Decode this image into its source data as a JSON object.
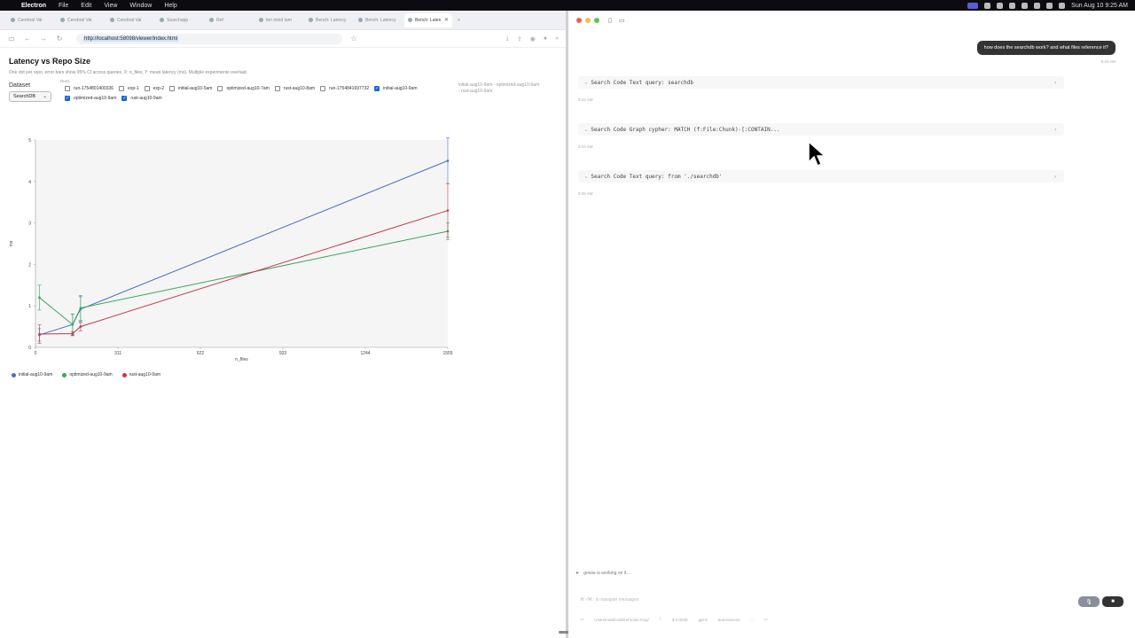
{
  "menubar": {
    "app": "Electron",
    "items": [
      "File",
      "Edit",
      "View",
      "Window",
      "Help"
    ],
    "clock": "Sun Aug 10  9:25 AM"
  },
  "browser": {
    "tabs": [
      "Cerebral Val",
      "Cerebral Val",
      "Cerebral Val",
      "Searchapp",
      "Ref",
      "ten mind tam",
      "Bench: Latency",
      "Bench: Latency",
      "Bench: Laten"
    ],
    "url": "http://localhost:58098/viewer/index.html"
  },
  "page": {
    "title": "Latency vs Repo Size",
    "subtitle": "One dot per repo, error bars show 95% CI across queries. X: n_files, Y: mean latency (ms). Multiple experiments overlaid.",
    "dataset_label": "Dataset",
    "runs_label": "Runs",
    "dataset_value": "SearchDB",
    "runs": [
      {
        "label": "run-1754801400336",
        "checked": false
      },
      {
        "label": "exp-1",
        "checked": false
      },
      {
        "label": "exp-2",
        "checked": false
      },
      {
        "label": "initial-aug10-5am",
        "checked": false
      },
      {
        "label": "optimized-aug10-7am",
        "checked": false
      },
      {
        "label": "rust-aug10-8am",
        "checked": false
      },
      {
        "label": "run-1754841697732",
        "checked": false
      },
      {
        "label": "initial-aug10-9am",
        "checked": true
      },
      {
        "label": "optimized-aug10-9am",
        "checked": true
      },
      {
        "label": "rust-aug10-9am",
        "checked": true
      }
    ],
    "selected_summary": "initial-aug10-9am · optimized-aug10-9am · rust-aug10-9am"
  },
  "chart_data": {
    "type": "line",
    "xlabel": "n_files",
    "ylabel": "ms",
    "xlim": [
      0,
      1555
    ],
    "ylim": [
      0,
      5
    ],
    "xticks": [
      0,
      311,
      622,
      933,
      1244,
      1555
    ],
    "yticks": [
      0,
      1,
      2,
      3,
      4,
      5
    ],
    "grid": false,
    "legend_position": "bottom-left",
    "series": [
      {
        "name": "initial-aug10-9am",
        "color": "#4a6fc4",
        "x": [
          15,
          140,
          170,
          1555
        ],
        "y": [
          0.3,
          0.55,
          0.92,
          4.5
        ],
        "err": [
          0.15,
          0.25,
          0.3,
          0.55
        ]
      },
      {
        "name": "optimized-aug10-9am",
        "color": "#3aa55c",
        "x": [
          15,
          140,
          170,
          1555
        ],
        "y": [
          1.2,
          0.55,
          0.95,
          2.8
        ],
        "err": [
          0.3,
          0.25,
          0.3,
          0.2
        ]
      },
      {
        "name": "rust-aug10-9am",
        "color": "#c0394b",
        "x": [
          15,
          140,
          170,
          1555
        ],
        "y": [
          0.32,
          0.33,
          0.5,
          3.3
        ],
        "err": [
          0.22,
          0.05,
          0.1,
          0.65
        ]
      }
    ]
  },
  "chat": {
    "user_message": "how does the searchdb work? and what files reference it?",
    "user_time": "9:24 AM",
    "tool_calls": [
      {
        "text": "Search Code Text query: searchdb",
        "time": "9:24 AM"
      },
      {
        "text": "Search Code Graph cypher: MATCH (f:File:Chunk)-[:CONTAIN...",
        "time": "9:24 AM"
      },
      {
        "text": "Search Code Text query: from './searchdb'",
        "time": "9:25 AM"
      }
    ],
    "working": "goose is working on it…",
    "hint": "⌘↑/⌘↓ to navigate messages",
    "status": {
      "path": "Users/matt/code/ref-tools-mcp/",
      "cost": "$ 0.0039",
      "model": "gpt-5",
      "mode": "autonomous"
    }
  }
}
